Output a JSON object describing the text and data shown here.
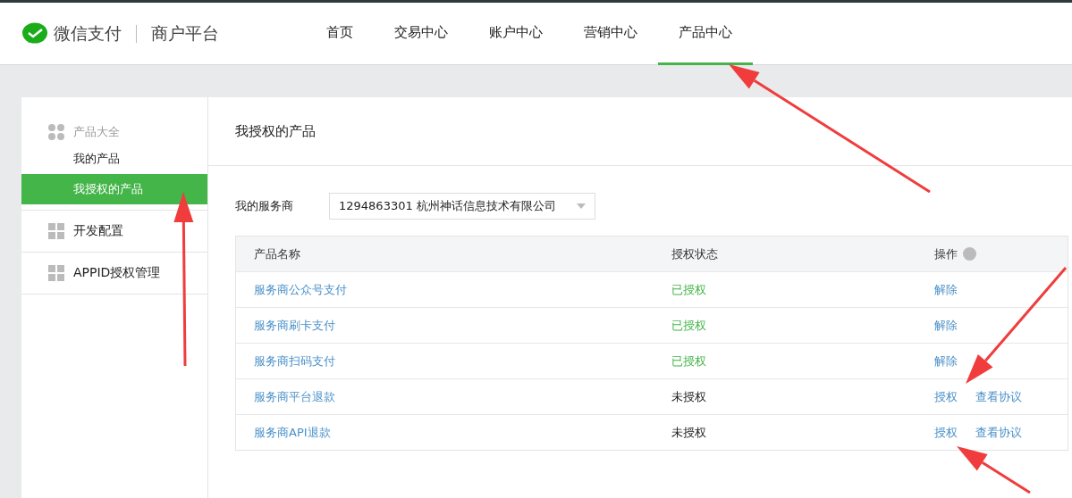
{
  "header": {
    "brand": "微信支付",
    "platform": "商户平台",
    "nav": [
      {
        "label": "首页",
        "selected": false
      },
      {
        "label": "交易中心",
        "selected": false
      },
      {
        "label": "账户中心",
        "selected": false
      },
      {
        "label": "营销中心",
        "selected": false
      },
      {
        "label": "产品中心",
        "selected": true
      }
    ]
  },
  "sidebar": {
    "groups": [
      {
        "label": "产品大全",
        "kind": "header",
        "children": [
          {
            "label": "我的产品",
            "selected": false
          },
          {
            "label": "我授权的产品",
            "selected": true
          }
        ]
      },
      {
        "label": "开发配置",
        "kind": "item"
      },
      {
        "label": "APPID授权管理",
        "kind": "item"
      }
    ]
  },
  "main": {
    "title": "我授权的产品",
    "provider": {
      "label": "我的服务商",
      "value": "1294863301 杭州神话信息技术有限公司"
    },
    "table": {
      "columns": [
        "产品名称",
        "授权状态",
        "操作"
      ],
      "rows": [
        {
          "name": "服务商公众号支付",
          "status": "已授权",
          "authorized": true,
          "actions": [
            "解除"
          ]
        },
        {
          "name": "服务商刷卡支付",
          "status": "已授权",
          "authorized": true,
          "actions": [
            "解除"
          ]
        },
        {
          "name": "服务商扫码支付",
          "status": "已授权",
          "authorized": true,
          "actions": [
            "解除"
          ]
        },
        {
          "name": "服务商平台退款",
          "status": "未授权",
          "authorized": false,
          "actions": [
            "授权",
            "查看协议"
          ]
        },
        {
          "name": "服务商API退款",
          "status": "未授权",
          "authorized": false,
          "actions": [
            "授权",
            "查看协议"
          ]
        }
      ]
    }
  }
}
